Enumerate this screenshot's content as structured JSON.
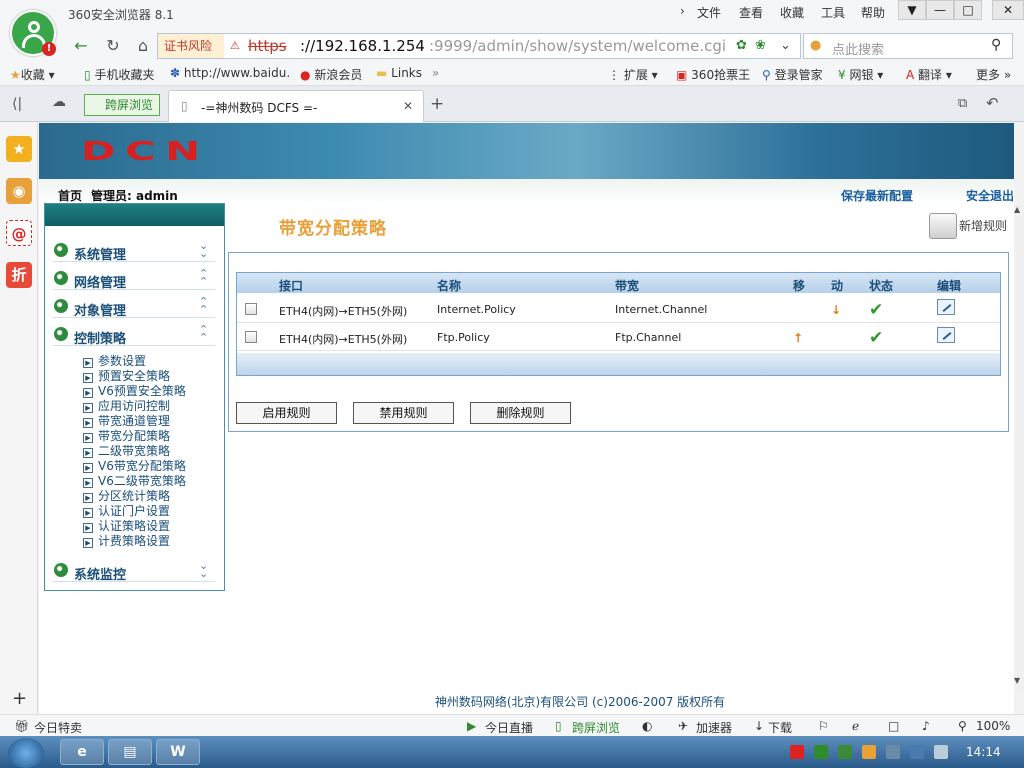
{
  "browser": {
    "app_title": "360安全浏览器 8.1",
    "menu": [
      "文件",
      "查看",
      "收藏",
      "工具",
      "帮助"
    ],
    "address": {
      "cert_warning": "证书风险",
      "scheme": "https",
      "host": "://192.168.1.254",
      "path": ":9999/admin/show/system/welcome.cgi"
    },
    "search_placeholder": "点此搜索",
    "bookmarks": [
      "收藏",
      "手机收藏夹",
      "http://www.baidu.",
      "新浪会员",
      "Links"
    ],
    "toolbar_right": [
      "扩展",
      "360抢票王",
      "登录管家",
      "网银",
      "翻译",
      "更多"
    ],
    "tabs": {
      "split_view": "跨屏浏览",
      "active_tab_title": "-=神州数码 DCFS =-"
    },
    "status": {
      "left": "今日特卖",
      "items": [
        "今日直播",
        "跨屏浏览",
        "加速器",
        "下载"
      ],
      "zoom": "100%"
    }
  },
  "app": {
    "banner_logo": "DCN",
    "header": {
      "home": "首页",
      "admin_label": "管理员: admin",
      "save_config": "保存最新配置",
      "logout": "安全退出"
    },
    "menu": {
      "sections": [
        {
          "label": "系统管理",
          "state": "collapsed"
        },
        {
          "label": "网络管理",
          "state": "expanded"
        },
        {
          "label": "对象管理",
          "state": "expanded"
        },
        {
          "label": "控制策略",
          "state": "expanded"
        },
        {
          "label": "系统监控",
          "state": "collapsed"
        }
      ],
      "control_policy_items": [
        "参数设置",
        "预置安全策略",
        "V6预置安全策略",
        "应用访问控制",
        "带宽通道管理",
        "带宽分配策略",
        "二级带宽策略",
        "V6带宽分配策略",
        "V6二级带宽策略",
        "分区统计策略",
        "认证门户设置",
        "认证策略设置",
        "计费策略设置"
      ]
    },
    "page": {
      "title": "带宽分配策略",
      "add_rule": "新增规则",
      "table": {
        "headers": [
          "接口",
          "名称",
          "带宽",
          "移",
          "动",
          "状态",
          "编辑"
        ],
        "rows": [
          {
            "interface": "ETH4(内网)→ETH5(外网)",
            "name": "Internet.Policy",
            "bandwidth": "Internet.Channel",
            "move": "↓",
            "status": "✔"
          },
          {
            "interface": "ETH4(内网)→ETH5(外网)",
            "name": "Ftp.Policy",
            "bandwidth": "Ftp.Channel",
            "move": "↑",
            "status": "✔"
          }
        ]
      },
      "buttons": [
        "启用规则",
        "禁用规则",
        "删除规则"
      ]
    },
    "footer": "神州数码网络(北京)有限公司 (c)2006-2007 版权所有"
  },
  "taskbar": {
    "clock": "14:14"
  }
}
